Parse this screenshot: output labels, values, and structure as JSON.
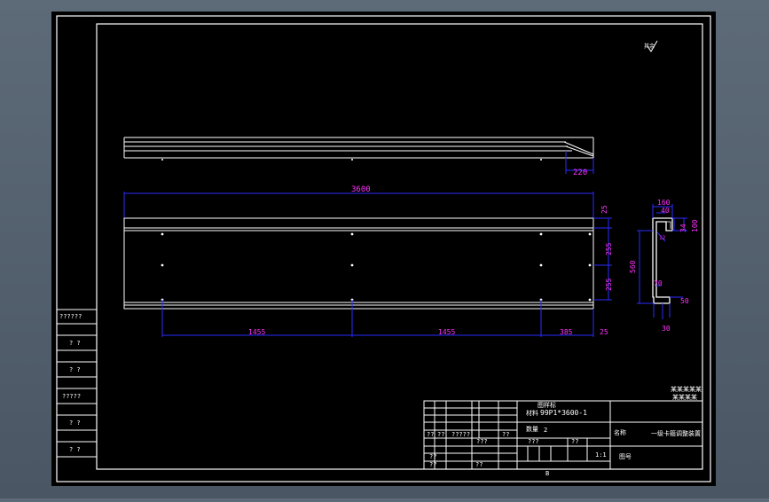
{
  "colors": {
    "background_outer": "#56626f",
    "sheet": "#000000",
    "frame": "#ffffff",
    "dimension": "#2b2bff",
    "dimension_text": "#ff33ff",
    "title_text": "#ffffff"
  },
  "top_view": {
    "dim_220": "220"
  },
  "front_view": {
    "overall_length": "3600",
    "right_dims": [
      "25",
      "255",
      "255",
      "25"
    ],
    "bottom_dims": [
      "1455",
      "1455",
      "385",
      "25"
    ]
  },
  "section": {
    "dims": {
      "top_width": "160",
      "top_inner": "40",
      "top_flange": "34",
      "right_height": "100",
      "height": "560",
      "lower_mid": "70",
      "lower_right": "50",
      "bottom": "30",
      "small": "12"
    }
  },
  "roughness_mark": "其余",
  "left_margin_labels": [
    "??????",
    "? ?",
    "? ?",
    "?????",
    "? ?",
    "? ?"
  ],
  "title_block": {
    "part_code": "99P1*3600-1",
    "header_label": "图样标",
    "row_label_1": "材料",
    "row_label_2": "数量",
    "quantity": "2",
    "company_line_1": "某某某某某",
    "company_line_2": "某某某某",
    "name_label": "名称",
    "name_value": "一级卡箍调整装置",
    "cells": [
      "??",
      "??",
      "?????",
      "???",
      "??",
      "???",
      "??",
      "1:1",
      "??",
      "??",
      "??"
    ],
    "bottom_mark": "B",
    "sheet_mark": "图号"
  }
}
